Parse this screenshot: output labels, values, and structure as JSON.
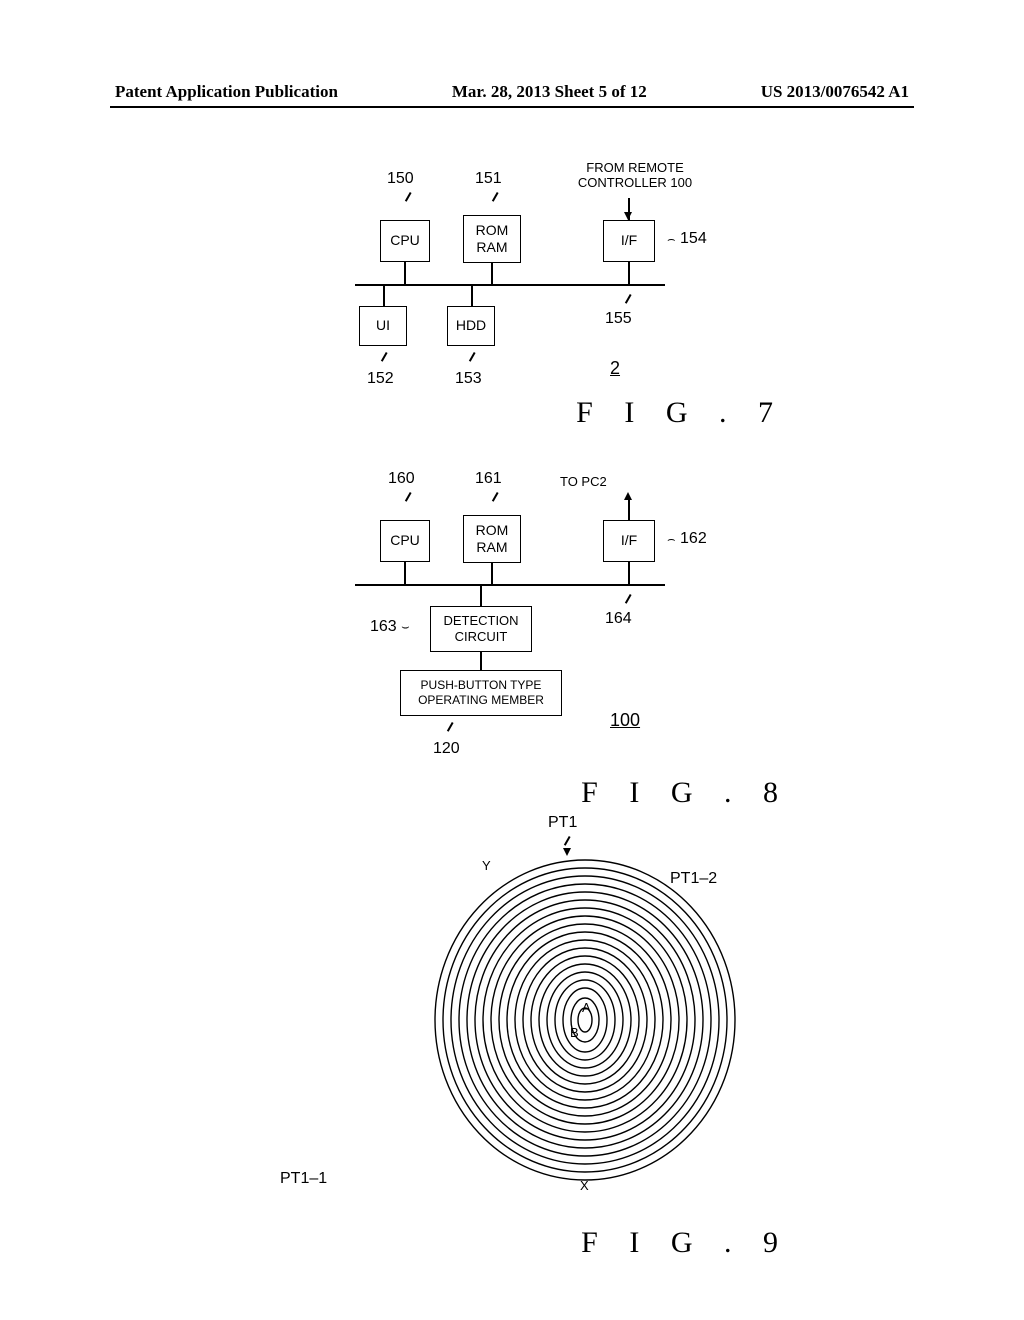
{
  "header": {
    "left": "Patent Application Publication",
    "center": "Mar. 28, 2013  Sheet 5 of 12",
    "right": "US 2013/0076542 A1"
  },
  "fig7": {
    "caption": "F I G .  7",
    "input_label": "FROM REMOTE\nCONTROLLER 100",
    "blocks": {
      "cpu": "CPU",
      "romram": "ROM\nRAM",
      "if": "I/F",
      "ui": "UI",
      "hdd": "HDD"
    },
    "refs": {
      "cpu": "150",
      "romram": "151",
      "if": "154",
      "ui": "152",
      "hdd": "153",
      "bus": "155",
      "device": "2"
    }
  },
  "fig8": {
    "caption": "F I G .  8",
    "input_label": "TO PC2",
    "blocks": {
      "cpu": "CPU",
      "romram": "ROM\nRAM",
      "if": "I/F",
      "detection": "DETECTION\nCIRCUIT",
      "push": "PUSH-BUTTON TYPE\nOPERATING MEMBER"
    },
    "refs": {
      "cpu": "160",
      "romram": "161",
      "if": "162",
      "detection": "163",
      "bus": "164",
      "push": "120",
      "device": "100"
    }
  },
  "fig9": {
    "caption": "F I G .  9",
    "labels": {
      "pt1": "PT1",
      "pt1_1": "PT1–1",
      "pt1_2": "PT1–2",
      "A": "A",
      "B": "B",
      "X": "X",
      "Y": "Y"
    }
  },
  "chart_data": {
    "type": "diagram",
    "figures": [
      {
        "id": "FIG7",
        "kind": "block-diagram",
        "device_ref": "2",
        "bus_ref": "155",
        "external_input": "FROM REMOTE CONTROLLER 100 → I/F",
        "blocks": [
          {
            "ref": "150",
            "label": "CPU"
          },
          {
            "ref": "151",
            "label": "ROM / RAM"
          },
          {
            "ref": "154",
            "label": "I/F"
          },
          {
            "ref": "152",
            "label": "UI"
          },
          {
            "ref": "153",
            "label": "HDD"
          }
        ],
        "connections": [
          "CPU—bus",
          "ROM/RAM—bus",
          "I/F—bus",
          "UI—bus",
          "HDD—bus"
        ]
      },
      {
        "id": "FIG8",
        "kind": "block-diagram",
        "device_ref": "100",
        "bus_ref": "164",
        "external_output": "I/F → TO PC2",
        "blocks": [
          {
            "ref": "160",
            "label": "CPU"
          },
          {
            "ref": "161",
            "label": "ROM / RAM"
          },
          {
            "ref": "162",
            "label": "I/F"
          },
          {
            "ref": "163",
            "label": "DETECTION CIRCUIT"
          },
          {
            "ref": "120",
            "label": "PUSH-BUTTON TYPE OPERATING MEMBER"
          }
        ],
        "connections": [
          "CPU—bus",
          "ROM/RAM—bus",
          "I/F—bus",
          "DETECTION CIRCUIT—bus",
          "PUSH-BUTTON TYPE OPERATING MEMBER—DETECTION CIRCUIT"
        ]
      },
      {
        "id": "FIG9",
        "kind": "double-spiral-pattern",
        "labels": [
          "PT1",
          "PT1-1",
          "PT1-2",
          "A",
          "B",
          "X",
          "Y"
        ],
        "spirals": [
          {
            "name": "PT1-1 (outer)",
            "turns": 11,
            "end_marker": "X"
          },
          {
            "name": "PT1-2 (inner)",
            "turns": 11,
            "end_marker": "Y"
          }
        ],
        "center_points": [
          "A",
          "B"
        ]
      }
    ]
  }
}
